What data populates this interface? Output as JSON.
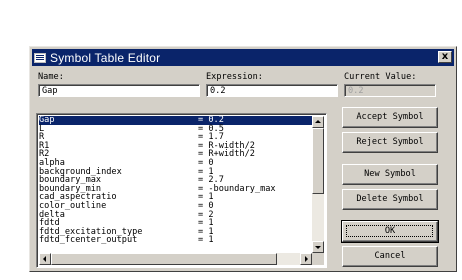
{
  "window": {
    "title": "Symbol Table Editor",
    "close_glyph": "x"
  },
  "labels": {
    "name": "Name:",
    "expression": "Expression:",
    "current_value": "Current Value:"
  },
  "fields": {
    "name": "Gap",
    "expression": "0.2",
    "current_value": "0.2"
  },
  "symbols": [
    {
      "name": "Gap",
      "value": "= 0.2",
      "selected": true
    },
    {
      "name": "L",
      "value": "= 0.5"
    },
    {
      "name": "R",
      "value": "= 1.7"
    },
    {
      "name": "R1",
      "value": "= R-width/2"
    },
    {
      "name": "R2",
      "value": "= R+width/2"
    },
    {
      "name": "alpha",
      "value": "= 0"
    },
    {
      "name": "background_index",
      "value": "= 1"
    },
    {
      "name": "boundary_max",
      "value": "= 2.7"
    },
    {
      "name": "boundary_min",
      "value": "= -boundary_max"
    },
    {
      "name": "cad_aspectratio",
      "value": "= 1"
    },
    {
      "name": "color_outline",
      "value": "= 0"
    },
    {
      "name": "delta",
      "value": "= 2"
    },
    {
      "name": "fdtd",
      "value": "= 1"
    },
    {
      "name": "fdtd_excitation_type",
      "value": "= 1"
    },
    {
      "name": "fdtd_fcenter_output",
      "value": "= 1"
    }
  ],
  "buttons": {
    "accept": "Accept Symbol",
    "reject": "Reject Symbol",
    "new": "New Symbol",
    "delete": "Delete Symbol",
    "ok": "OK",
    "cancel": "Cancel"
  },
  "colors": {
    "selection": "#0a246a",
    "titlebar": "#0a246a",
    "face": "#d4d0c8"
  }
}
